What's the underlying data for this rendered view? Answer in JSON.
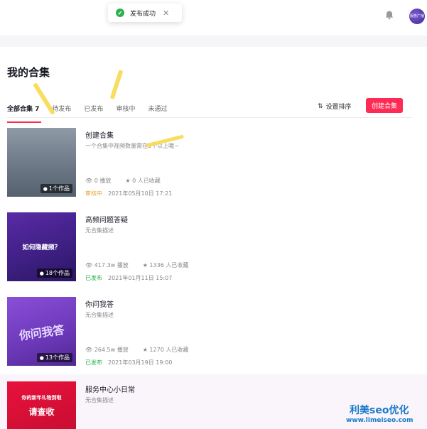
{
  "toast": {
    "text": "发布成功",
    "close": "✕",
    "icon": "check-circle-icon"
  },
  "header": {
    "avatar_text": "服务广播"
  },
  "page": {
    "title": "我的合集"
  },
  "tabs": [
    {
      "label": "全部合集 7",
      "active": true
    },
    {
      "label": "待发布"
    },
    {
      "label": "已发布"
    },
    {
      "label": "审核中"
    },
    {
      "label": "未通过"
    }
  ],
  "toolbar": {
    "sort_label": "设置排序",
    "create_label": "创建合集"
  },
  "collections": [
    {
      "title": "创建合集",
      "desc": "一个合集中视频数量需在3个以上哦~",
      "count": "1个作品",
      "plays": "0 播放",
      "favs": "0 人已收藏",
      "status": "审核中",
      "date": "2021年05月10日 17:21"
    },
    {
      "title": "高频问题答疑",
      "desc": "无合集描述",
      "count": "18个作品",
      "thumb_text": "如何隐藏频？",
      "plays": "417.3w 播放",
      "favs": "1336 人已收藏",
      "status": "已发布",
      "date": "2021年01月11日 15:07"
    },
    {
      "title": "你问我答",
      "desc": "无合集描述",
      "count": "13个作品",
      "thumb_text": "你问我答",
      "plays": "264.5w 播放",
      "favs": "1270 人已收藏",
      "status": "已发布",
      "date": "2021年03月19日 19:00"
    },
    {
      "title": "服务中心小日常",
      "desc": "无合集描述",
      "thumb_text_1": "你的新年礼物到啦",
      "thumb_text_2": "请查收"
    }
  ],
  "watermark": {
    "line1": "利美seo优化",
    "line2": "www.limeiseo.com"
  },
  "colors": {
    "accent": "#fe2c55",
    "published": "#2bb24c",
    "review": "#e6a23c"
  }
}
